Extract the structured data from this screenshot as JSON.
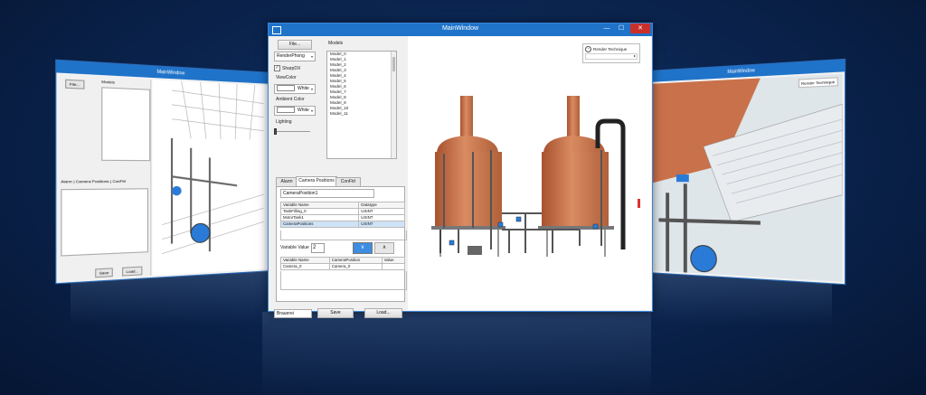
{
  "main_window": {
    "title": "MainWindow",
    "controls": {
      "minimize": "—",
      "maximize": "☐",
      "close": "✕"
    },
    "file_button": "File...",
    "models_label": "Models",
    "shader_combo": "RenderPhong",
    "sharpdx_label": "SharpDX",
    "sharpdx_checked": "✓",
    "viewcolor_label": "ViewColor",
    "viewcolor_value": "White",
    "ambient_label": "Ambient Color",
    "ambient_value": "White",
    "lighting_label": "Lighting",
    "models": [
      "Model_0",
      "Model_1",
      "Model_2",
      "Model_3",
      "Model_4",
      "Model_5",
      "Model_6",
      "Model_7",
      "Model_8",
      "Model_9",
      "Model_10",
      "Model_11"
    ],
    "tabs": [
      "Alarm",
      "Camera Positions",
      "ConFtrl"
    ],
    "camera_field": "CameraPosition1",
    "var_table": {
      "headers": [
        "Variable Name",
        "Datatype"
      ],
      "rows": [
        [
          "TankFilling_0",
          "USINT"
        ],
        [
          "MotorTank1",
          "USINT"
        ],
        [
          "CameraPositions",
          "USINT"
        ]
      ]
    },
    "variable_value_label": "Variable Value",
    "variable_value": "2",
    "nav_down": "∨",
    "nav_up": "∧",
    "pos_table": {
      "headers": [
        "Variable Name",
        "CameraPosition",
        "Value"
      ],
      "rows": [
        [
          "Camera_0",
          "Camera_0",
          ""
        ]
      ]
    },
    "filename_field": "Brauerei",
    "save_button": "Save",
    "load_button": "Load...",
    "render_technique_label": "Render Technique",
    "render_technique_icon": "⌃",
    "scroll_right_arrow": "▸"
  },
  "left_window": {
    "title": "MainWindow",
    "file_button": "File...",
    "models_label": "Models",
    "tabs": [
      "Alarm",
      "Camera Positions",
      "ConFtrl"
    ],
    "save": "Save",
    "load": "Load..."
  },
  "right_window": {
    "title": "MainWindow",
    "render_technique_label": "Render Technique"
  },
  "colors": {
    "title_blue": "#1f73c9",
    "copper": "#c9714a",
    "selection": "#cfe3f7"
  }
}
